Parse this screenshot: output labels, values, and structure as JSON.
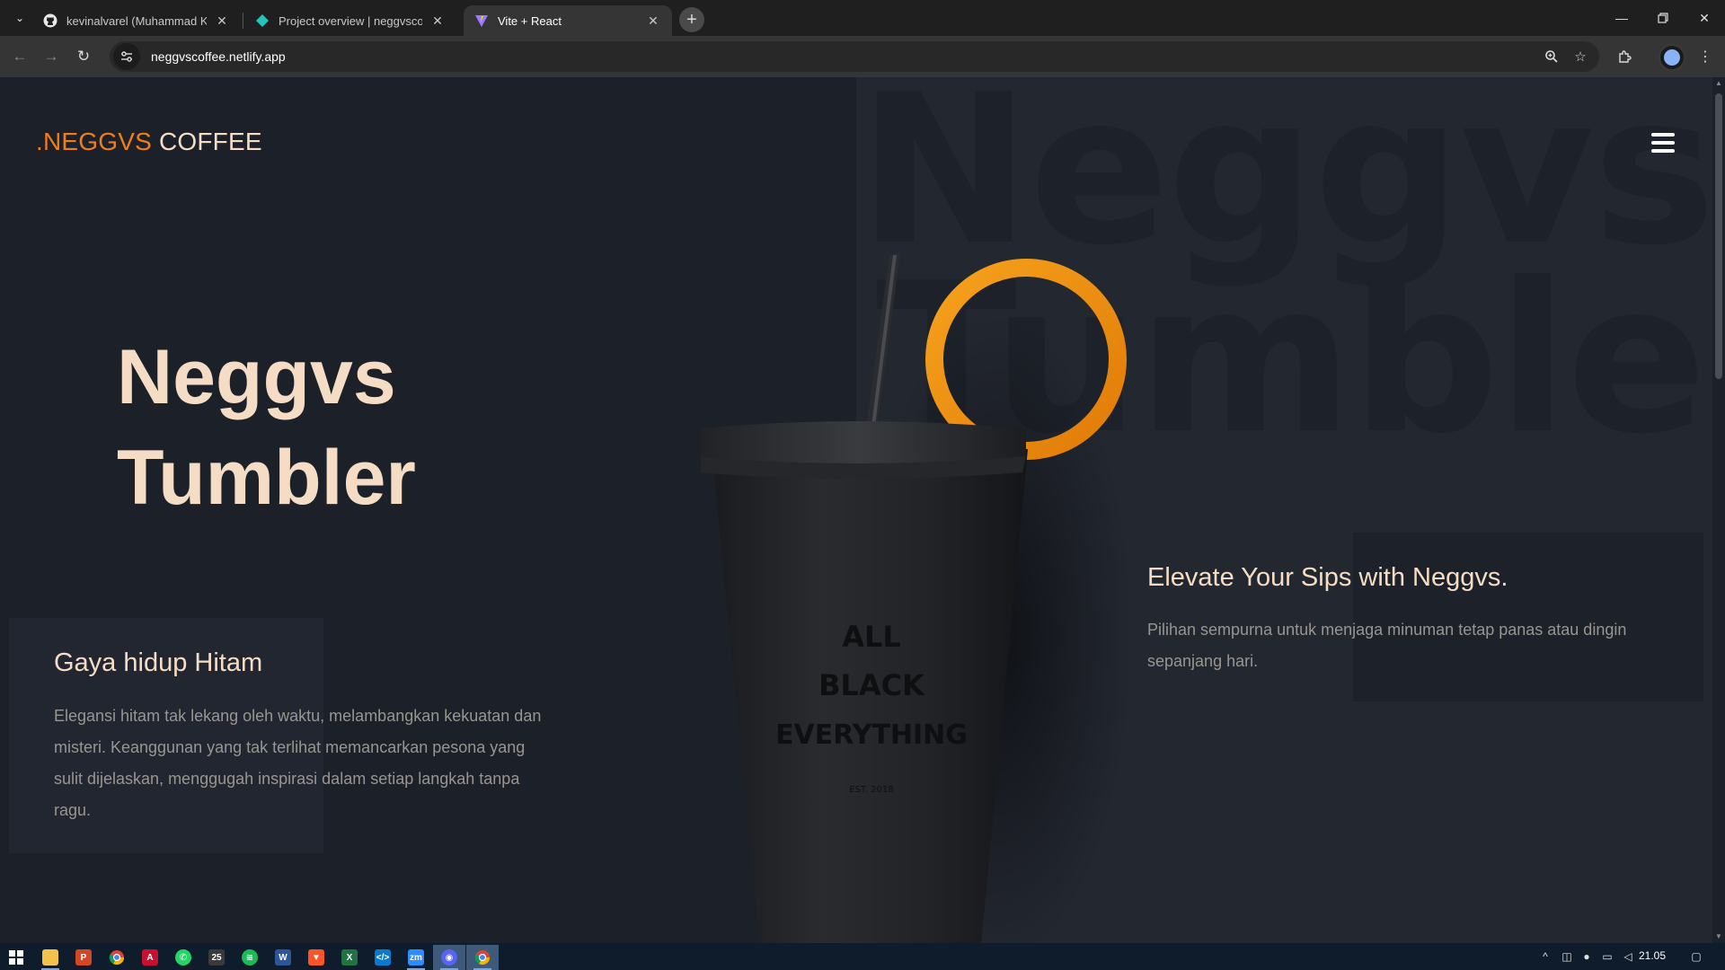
{
  "browser": {
    "tabs": [
      {
        "title": "kevinalvarel (Muhammad Kevin",
        "icon": "github-icon",
        "active": false
      },
      {
        "title": "Project overview | neggvscoffee",
        "icon": "netlify-icon",
        "active": false
      },
      {
        "title": "Vite + React",
        "icon": "vite-icon",
        "active": true
      }
    ],
    "url": "neggvscoffee.netlify.app"
  },
  "site": {
    "logo": {
      "dot": ".",
      "brand": "NEGGVS",
      "rest": " COFFEE"
    },
    "bg_words": [
      "Neggvs",
      "Tumbler"
    ],
    "hero": {
      "line1": "Neggvs",
      "line2": "Tumbler"
    },
    "left": {
      "heading": "Gaya hidup Hitam",
      "body": "Elegansi hitam tak lekang oleh waktu, melambangkan kekuatan dan misteri. Keanggunan yang tak terlihat memancarkan pesona yang sulit dijelaskan, menggugah inspirasi dalam setiap langkah tanpa ragu."
    },
    "right": {
      "heading": "Elevate Your Sips with Neggvs.",
      "body": "Pilihan sempurna untuk menjaga minuman tetap panas atau dingin sepanjang hari."
    },
    "tumbler_print": {
      "line1": "ALL",
      "line2": "BLACK",
      "line3": "EVERYTHING",
      "est": "EST. 2018"
    },
    "colors": {
      "accent": "#f07d1a",
      "cream": "#f5ddc5",
      "ring": "#f0900f",
      "bg": "#1c2029"
    }
  },
  "taskbar": {
    "apps": [
      "start-icon",
      "file-explorer-icon",
      "powerpoint-icon",
      "chrome-icon",
      "acrobat-icon",
      "whatsapp-icon",
      "calendar-icon",
      "spotify-icon",
      "word-icon",
      "brave-icon",
      "excel-icon",
      "vscode-icon",
      "zoom-icon",
      "discord-icon",
      "chrome-icon"
    ],
    "calendar_day": "25",
    "clock": "21.05"
  }
}
